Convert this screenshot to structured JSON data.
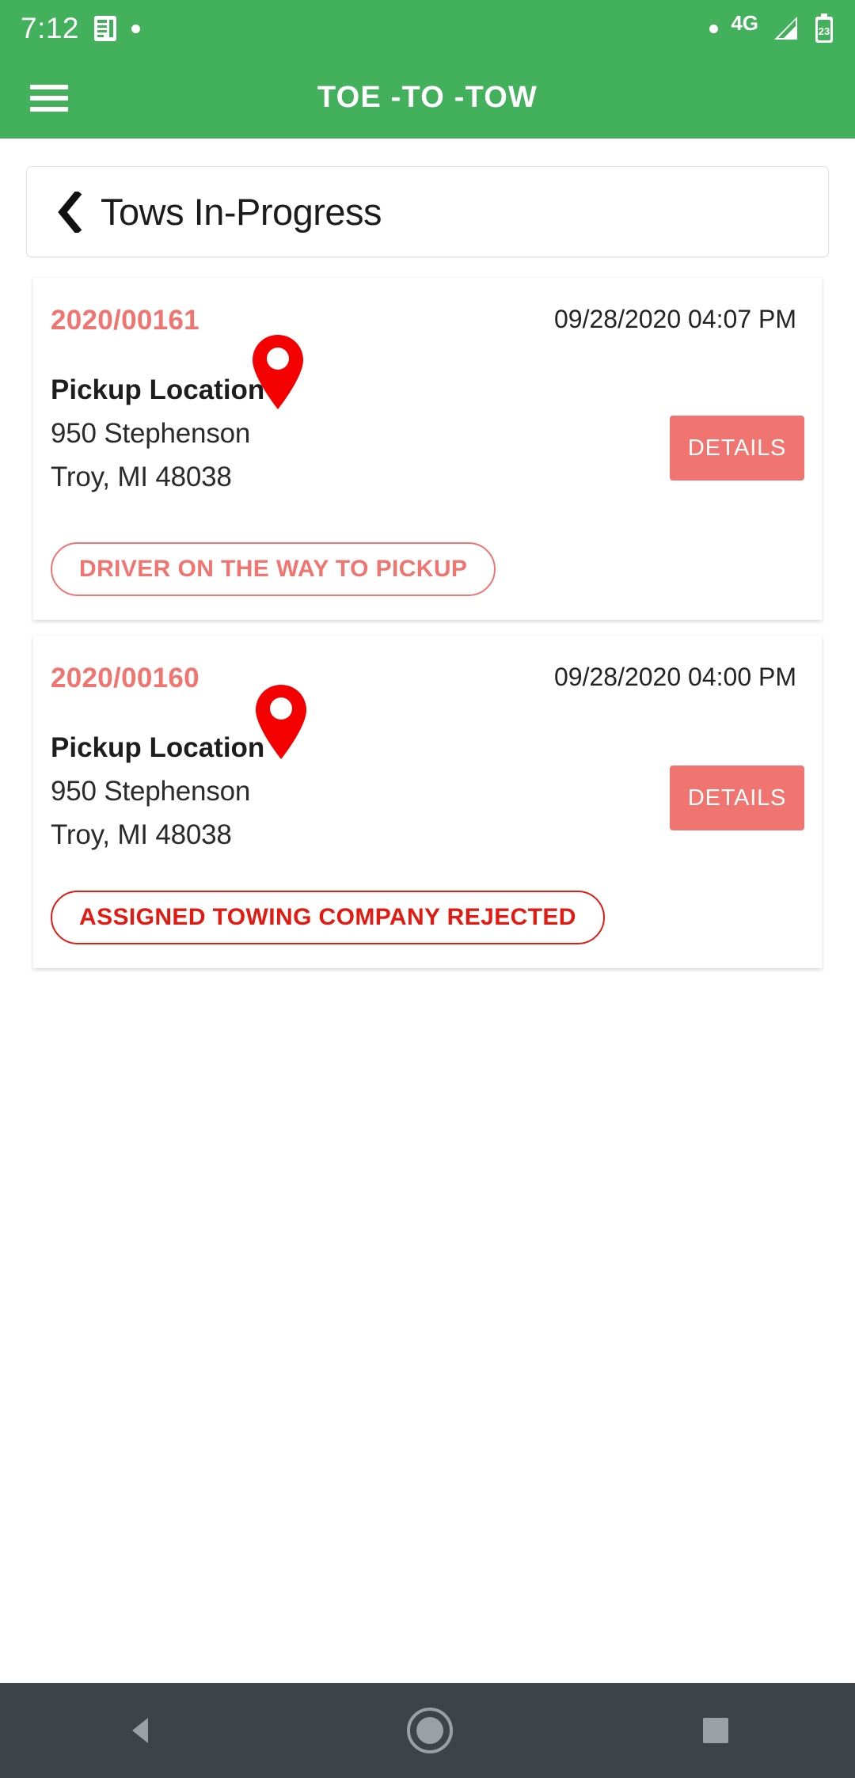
{
  "status_bar": {
    "time": "7:12",
    "network": "4G",
    "battery_level": "23",
    "icons": [
      "news-icon",
      "dot-icon",
      "dot-icon",
      "signal-icon",
      "battery-icon"
    ]
  },
  "app_bar": {
    "menu_icon": "hamburger-menu-icon",
    "title": "TOE -TO -TOW"
  },
  "page_header": {
    "back_icon": "back-chevron-icon",
    "title": "Tows In-Progress"
  },
  "colors": {
    "brand_green": "#43b05c",
    "accent_salmon": "#f07470",
    "danger_red": "#e21b12",
    "pin_red": "#f50000",
    "nav_bar": "#3d4348"
  },
  "cards": [
    {
      "reference": "2020/00161",
      "datetime": "09/28/2020 04:07 PM",
      "pin_icon": "map-pin-icon",
      "location_label": "Pickup Location",
      "address_line1": "950 Stephenson",
      "address_line2": "Troy, MI 48038",
      "details_label": "DETAILS",
      "status": "DRIVER ON THE WAY TO PICKUP",
      "status_style": "accent"
    },
    {
      "reference": "2020/00160",
      "datetime": "09/28/2020 04:00 PM",
      "pin_icon": "map-pin-icon",
      "location_label": "Pickup Location",
      "address_line1": "950 Stephenson",
      "address_line2": "Troy, MI 48038",
      "details_label": "DETAILS",
      "status": "ASSIGNED TOWING COMPANY REJECTED",
      "status_style": "danger"
    }
  ],
  "nav_bar": {
    "back_icon": "nav-back-triangle-icon",
    "home_icon": "nav-home-circle-icon",
    "recents_icon": "nav-recents-square-icon"
  }
}
